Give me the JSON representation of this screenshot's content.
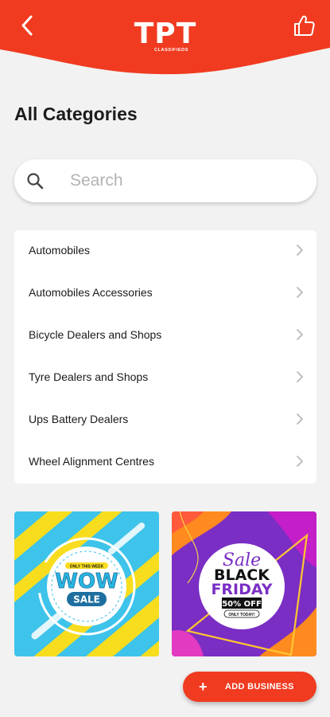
{
  "header": {
    "logo_text": "TPT",
    "logo_subtext": "CLASSIFIEDS",
    "back_icon": "chevron-left-icon",
    "like_icon": "thumbs-up-icon",
    "bg_color": "#f03b20"
  },
  "page": {
    "title": "All Categories"
  },
  "search": {
    "placeholder": "Search",
    "value": "",
    "icon": "search-icon"
  },
  "categories": [
    {
      "label": "Automobiles"
    },
    {
      "label": "Automobiles Accessories"
    },
    {
      "label": "Bicycle Dealers and Shops"
    },
    {
      "label": "Tyre Dealers and Shops"
    },
    {
      "label": "Ups Battery Dealers"
    },
    {
      "label": "Wheel Alignment Centres"
    }
  ],
  "banners": {
    "wow": {
      "top_text": "ONLY THIS WEEK",
      "title": "WOW",
      "subtitle": "SALE"
    },
    "black_friday": {
      "sale": "Sale",
      "line1": "BLACK",
      "line2": "FRIDAY",
      "discount": "50% OFF",
      "note": "ONLY TODAY!"
    }
  },
  "fab": {
    "icon": "plus-icon",
    "label": "ADD BUSINESS"
  }
}
